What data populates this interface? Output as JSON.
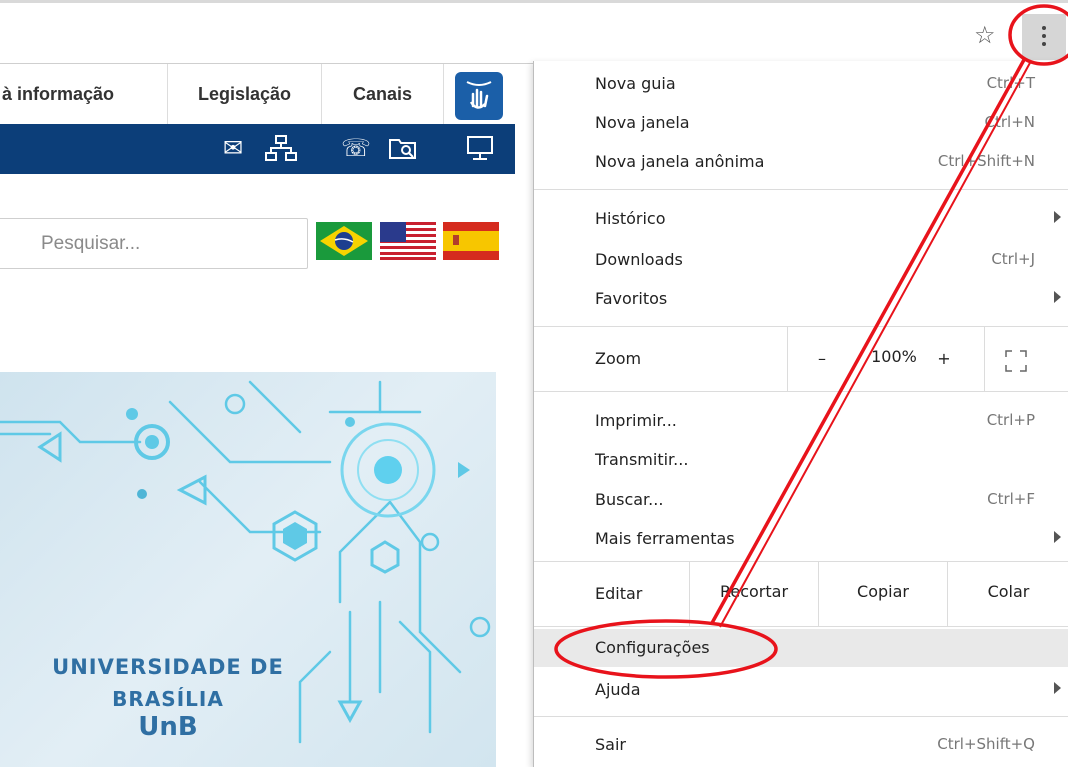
{
  "browser": {
    "star_glyph": "☆",
    "menu_icon": "three-dots-vertical"
  },
  "site": {
    "nav": [
      {
        "label": "à informação"
      },
      {
        "label": "Legislação"
      },
      {
        "label": "Canais"
      }
    ],
    "accessibility_icon": "sign-language-icon",
    "topbar_icons": [
      "✉",
      "品",
      "☏",
      "⌕",
      "🖵"
    ],
    "search_placeholder": "Pesquisar...",
    "flags": [
      "brazil-flag",
      "usa-flag",
      "spain-flag"
    ],
    "banner": {
      "line1": "UNIVERSIDADE DE",
      "line2": "BRASÍLIA",
      "line3": "UnB"
    }
  },
  "menu": {
    "group1": [
      {
        "label": "Nova guia",
        "shortcut": "Ctrl+T"
      },
      {
        "label": "Nova janela",
        "shortcut": "Ctrl+N"
      },
      {
        "label": "Nova janela anônima",
        "shortcut": "Ctrl+Shift+N"
      }
    ],
    "group2": [
      {
        "label": "Histórico",
        "shortcut": ""
      },
      {
        "label": "Downloads",
        "shortcut": "Ctrl+J"
      },
      {
        "label": "Favoritos",
        "shortcut": ""
      }
    ],
    "zoom": {
      "label": "Zoom",
      "minus": "–",
      "value": "100%",
      "plus": "+"
    },
    "group3": [
      {
        "label": "Imprimir...",
        "shortcut": "Ctrl+P"
      },
      {
        "label": "Transmitir...",
        "shortcut": ""
      },
      {
        "label": "Buscar...",
        "shortcut": "Ctrl+F"
      },
      {
        "label": "Mais ferramentas",
        "shortcut": ""
      }
    ],
    "edit": {
      "label": "Editar",
      "cut": "Recortar",
      "copy": "Copiar",
      "paste": "Colar"
    },
    "group4": [
      {
        "label": "Configurações",
        "shortcut": ""
      },
      {
        "label": "Ajuda",
        "shortcut": ""
      }
    ],
    "exit": {
      "label": "Sair",
      "shortcut": "Ctrl+Shift+Q"
    }
  },
  "annotation": {
    "color": "#e8131b"
  }
}
